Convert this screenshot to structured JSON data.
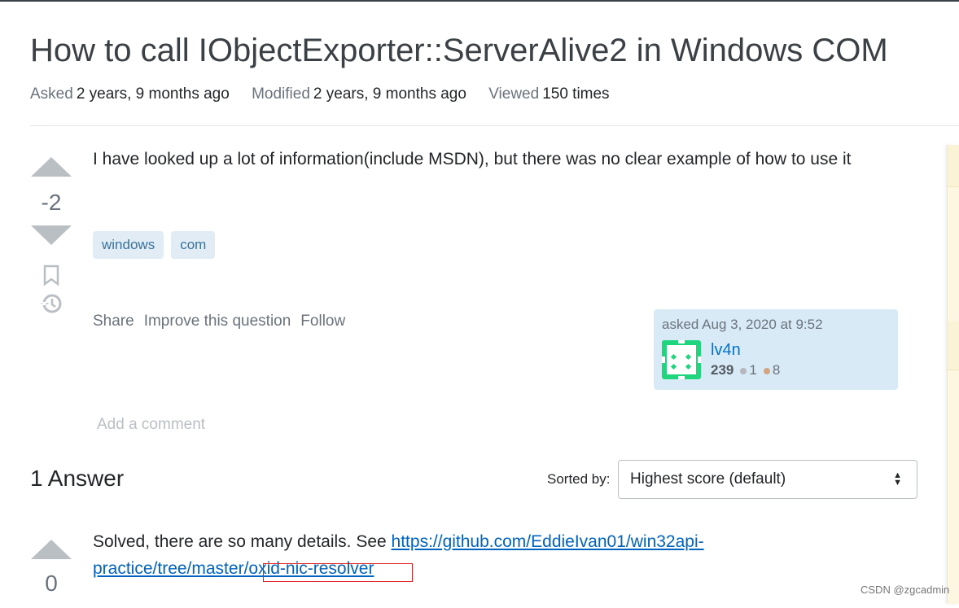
{
  "question": {
    "title": "How to call IObjectExporter::ServerAlive2 in Windows COM",
    "asked_label": "Asked",
    "asked_value": "2 years, 9 months ago",
    "modified_label": "Modified",
    "modified_value": "2 years, 9 months ago",
    "viewed_label": "Viewed",
    "viewed_value": "150 times",
    "score": "-2",
    "body": "I have looked up a lot of information(include MSDN), but there was no clear example of how to use it",
    "tags": [
      "windows",
      "com"
    ],
    "actions": {
      "share": "Share",
      "improve": "Improve this question",
      "follow": "Follow"
    },
    "user": {
      "asked": "asked Aug 3, 2020 at 9:52",
      "name": "lv4n",
      "reputation": "239",
      "silver": "1",
      "bronze": "8",
      "silver_color": "#b4b8bc",
      "bronze_color": "#d1a684"
    },
    "add_comment": "Add a comment"
  },
  "answers": {
    "count_label": "1 Answer",
    "sorted_label": "Sorted by:",
    "sort_value": "Highest score (default)",
    "items": [
      {
        "score": "0",
        "text": "Solved, there are so many details. See ",
        "link_line1": "https://github.com/EddieIvan01/win32api-",
        "link_line2": "practice/tree/master/oxid-nic-resolver"
      }
    ]
  },
  "watermark": "CSDN @zgcadmin"
}
